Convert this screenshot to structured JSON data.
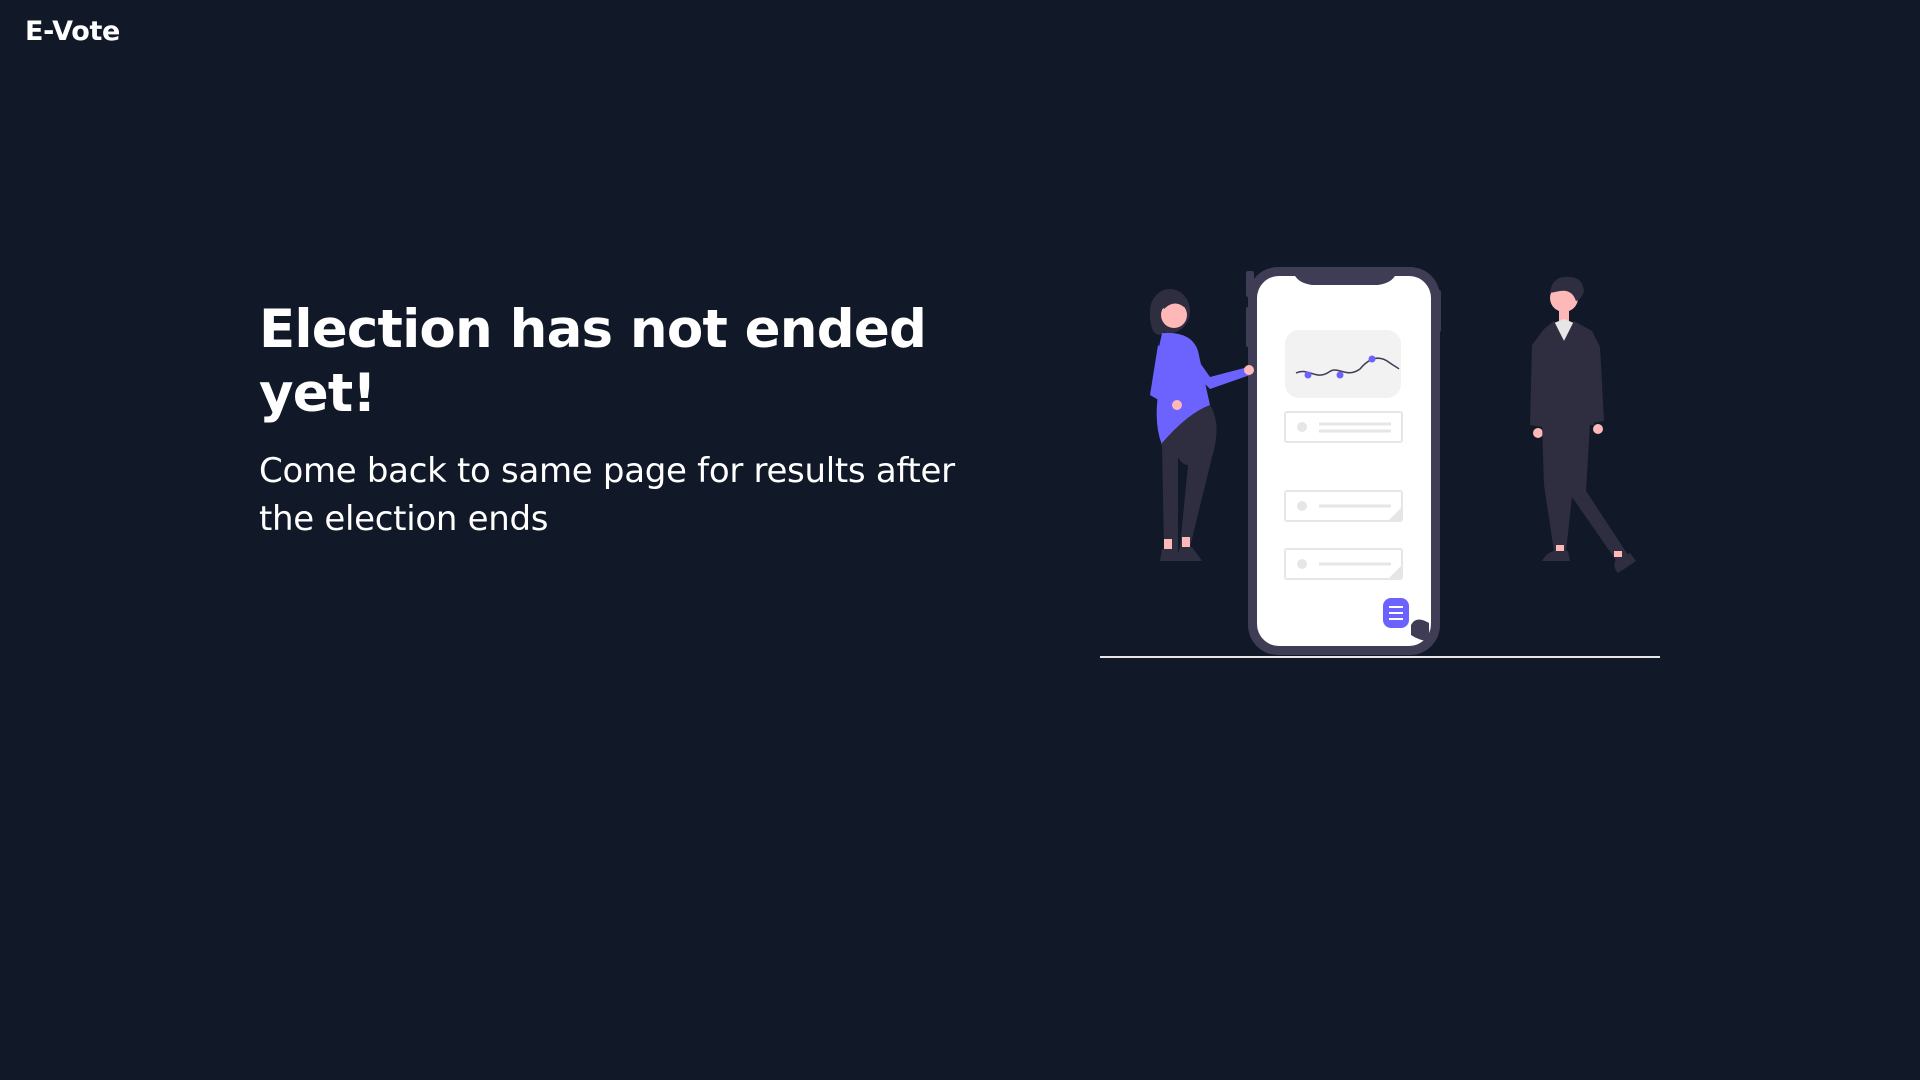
{
  "app": {
    "brand": "E-Vote"
  },
  "status": {
    "headline": "Election has not ended yet!",
    "message": "Come back to same page for results after the election ends"
  },
  "illustration": {
    "icon": "people-with-phone-ballot-illustration",
    "accent_color": "#6c63ff",
    "dark_color": "#2f2e41",
    "screen_color": "#ffffff",
    "card_color": "#f2f2f2",
    "ground_color": "#e6e6e6"
  }
}
